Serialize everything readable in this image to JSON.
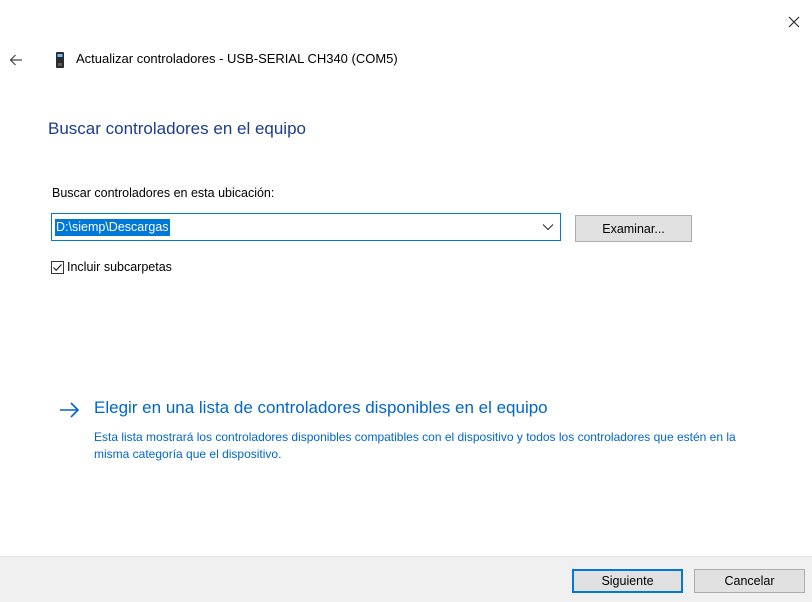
{
  "window": {
    "title": "Actualizar controladores - USB-SERIAL CH340 (COM5)",
    "close_icon": "close-icon",
    "back_icon": "back-arrow-icon",
    "device_icon": "usb-device-icon"
  },
  "main": {
    "heading": "Buscar controladores en el equipo",
    "location_label": "Buscar controladores en esta ubicación:",
    "path_value": "D:\\siemp\\Descargas",
    "browse_label": "Examinar...",
    "include_subfolders_label": "Incluir subcarpetas",
    "include_subfolders_checked": true
  },
  "choose": {
    "link_label": "Elegir en una lista de controladores disponibles en el equipo",
    "description": "Esta lista mostrará los controladores disponibles compatibles con el dispositivo y todos los controladores que estén en la misma categoría que el dispositivo."
  },
  "footer": {
    "next_label": "Siguiente",
    "cancel_label": "Cancelar"
  },
  "colors": {
    "heading": "#1c3d8c",
    "link": "#0066cc",
    "accent": "#0078d7",
    "footer_bg": "#f0f0f0"
  }
}
